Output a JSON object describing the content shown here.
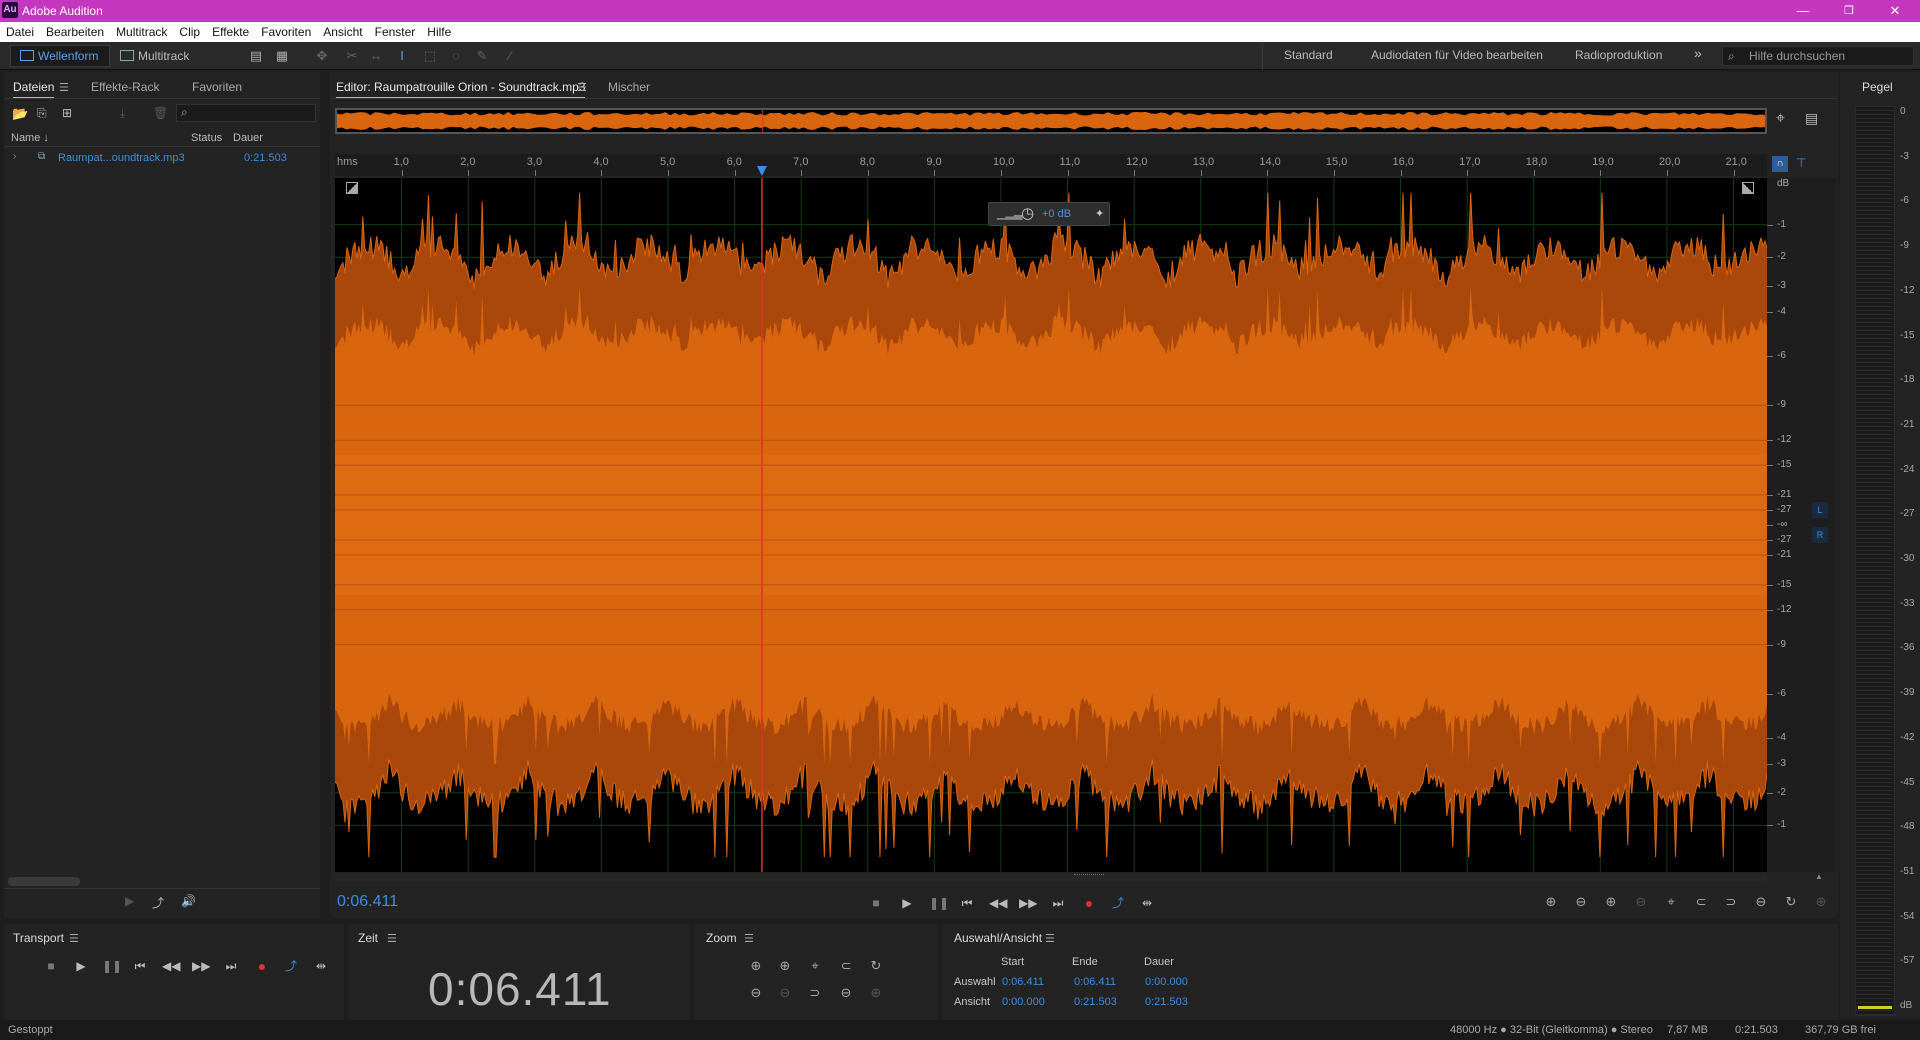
{
  "app": {
    "logo": "Au",
    "title": "Adobe Audition"
  },
  "window_controls": {
    "minimize": "—",
    "restore": "❐",
    "close": "✕"
  },
  "menu": [
    "Datei",
    "Bearbeiten",
    "Multitrack",
    "Clip",
    "Effekte",
    "Favoriten",
    "Ansicht",
    "Fenster",
    "Hilfe"
  ],
  "toolbar": {
    "mode_waveform": "Wellenform",
    "mode_multitrack": "Multitrack",
    "workspaces": [
      "Standard",
      "Audiodaten für Video bearbeiten",
      "Radioproduktion"
    ],
    "more": "»",
    "help_placeholder": "Hilfe durchsuchen"
  },
  "files_panel": {
    "tabs": [
      "Dateien",
      "Effekte-Rack",
      "Favoriten"
    ],
    "columns": {
      "name": "Name ↓",
      "status": "Status",
      "duration": "Dauer"
    },
    "rows": [
      {
        "name": "Raumpat...oundtrack.mp3",
        "duration": "0:21.503"
      }
    ]
  },
  "editor": {
    "tab_title": "Editor: Raumpatrouille Orion - Soundtrack.mp3",
    "tab_mixer": "Mischer",
    "ruler_unit": "hms",
    "ruler_ticks": [
      "1,0",
      "2,0",
      "3,0",
      "4,0",
      "5,0",
      "6,0",
      "7,0",
      "8,0",
      "9,0",
      "10,0",
      "11,0",
      "12,0",
      "13,0",
      "14,0",
      "15,0",
      "16,0",
      "17,0",
      "18,0",
      "19,0",
      "20,0",
      "21,0"
    ],
    "hud_gain": "+0 dB",
    "db_unit": "dB",
    "db_scale_top": [
      "-1",
      "-2",
      "-3",
      "-4",
      "-6",
      "-9",
      "-12",
      "-15",
      "-21",
      "-27"
    ],
    "db_scale_mid": "-∞",
    "db_scale_bottom": [
      "-27",
      "-21",
      "-15",
      "-12",
      "-9",
      "-6",
      "-4",
      "-3",
      "-2",
      "-1"
    ],
    "channel_l": "L",
    "channel_r": "R",
    "current_time": "0:06.411",
    "playhead_seconds": 6.411,
    "total_seconds": 21.503
  },
  "meter": {
    "title": "Pegel",
    "scale": [
      "0",
      "-3",
      "-6",
      "-9",
      "-12",
      "-15",
      "-18",
      "-21",
      "-24",
      "-27",
      "-30",
      "-33",
      "-36",
      "-39",
      "-42",
      "-45",
      "-48",
      "-51",
      "-54",
      "-57",
      "dB"
    ]
  },
  "transport_panel": {
    "title": "Transport"
  },
  "time_panel": {
    "title": "Zeit",
    "value": "0:06.411"
  },
  "zoom_panel": {
    "title": "Zoom"
  },
  "selection_panel": {
    "title": "Auswahl/Ansicht",
    "headers": [
      "Start",
      "Ende",
      "Dauer"
    ],
    "rows": [
      {
        "label": "Auswahl",
        "start": "0:06.411",
        "end": "0:06.411",
        "duration": "0:00.000"
      },
      {
        "label": "Ansicht",
        "start": "0:00.000",
        "end": "0:21.503",
        "duration": "0:21.503"
      }
    ]
  },
  "status_bar": {
    "state": "Gestoppt",
    "format": "48000 Hz ● 32-Bit (Gleitkomma) ● Stereo",
    "size": "7,87 MB",
    "duration": "0:21.503",
    "free": "367,79 GB frei"
  },
  "colors": {
    "titlebar": "#c637c0",
    "waveform": "#d9650f",
    "waveform_dark": "#a9480a",
    "playhead": "#e03030",
    "accent": "#3a8ee6",
    "record": "#e03030"
  }
}
